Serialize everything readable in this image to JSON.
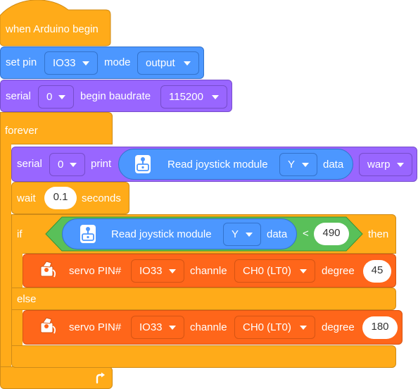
{
  "colors": {
    "events": "#FFAB19",
    "events_dark": "#CF8B17",
    "control": "#FFAB19",
    "control_dark": "#CF8B17",
    "pins": "#4C97FF",
    "pins_dark": "#3373CC",
    "serial": "#9966FF",
    "serial_dark": "#774DCB",
    "operator": "#59C059",
    "operator_dark": "#389438",
    "servo": "#FF661A",
    "servo_dark": "#D65413"
  },
  "hat": {
    "label": "when Arduino begin"
  },
  "set_pin": {
    "label": "set pin",
    "pin": "IO33",
    "mode_label": "mode",
    "mode": "output"
  },
  "serial_begin": {
    "label": "serial",
    "port": "0",
    "begin_label": "begin baudrate",
    "baud": "115200"
  },
  "forever": {
    "label": "forever",
    "loop_icon": "loop-arrow-icon"
  },
  "serial_print": {
    "label": "serial",
    "port": "0",
    "print_label": "print",
    "reporter": {
      "icon": "joystick-icon",
      "label": "Read joystick module",
      "axis": "Y",
      "data_label": "data"
    },
    "mode": "warp"
  },
  "wait": {
    "label": "wait",
    "value": "0.1",
    "unit": "seconds"
  },
  "if_else": {
    "if_label": "if",
    "then_label": "then",
    "else_label": "else",
    "condition": {
      "reporter": {
        "icon": "joystick-icon",
        "label": "Read joystick module",
        "axis": "Y",
        "data_label": "data"
      },
      "operator": "<",
      "value": "490"
    }
  },
  "servo1": {
    "icon": "servo-icon",
    "label": "servo PIN#",
    "pin": "IO33",
    "channel_label": "channle",
    "channel": "CH0 (LT0)",
    "degree_label": "degree",
    "degree": "45"
  },
  "servo2": {
    "icon": "servo-icon",
    "label": "servo PIN#",
    "pin": "IO33",
    "channel_label": "channle",
    "channel": "CH0 (LT0)",
    "degree_label": "degree",
    "degree": "180"
  }
}
